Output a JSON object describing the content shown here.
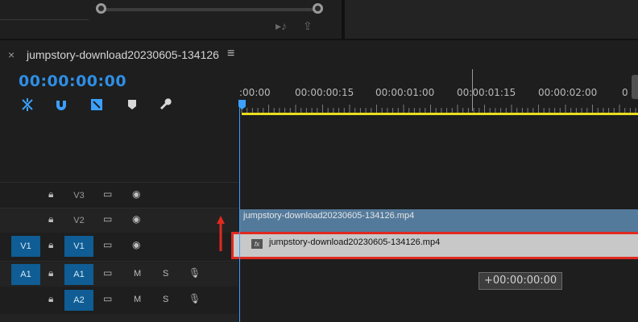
{
  "sequence": {
    "name": "jumpstory-download20230605-134126",
    "timecode": "00:00:00:00"
  },
  "ruler": {
    "labels": [
      ":00:00",
      "00:00:00:15",
      "00:00:01:00",
      "00:00:01:15",
      "00:00:02:00"
    ]
  },
  "tools": [
    "snap-icon",
    "magnet-icon",
    "linked-selection-icon",
    "marker-icon",
    "wrench-icon"
  ],
  "tracks": {
    "video": [
      {
        "name": "V3",
        "source": "",
        "active": false
      },
      {
        "name": "V2",
        "source": "",
        "active": false
      },
      {
        "name": "V1",
        "source": "V1",
        "active": true
      }
    ],
    "audio": [
      {
        "name": "A1",
        "source": "A1",
        "active": true,
        "mute": "M",
        "solo": "S"
      },
      {
        "name": "A2",
        "source": "",
        "active": false,
        "mute": "M",
        "solo": "S"
      }
    ]
  },
  "clips": {
    "v2": "jumpstory-download20230605-134126.mp4",
    "v1": "jumpstory-download20230605-134126.mp4",
    "fx_badge": "fx"
  },
  "tooltip": "+00:00:00:00",
  "colors": {
    "accent": "#2e8fe6",
    "work_area": "#e9dd1f",
    "highlight": "#e0291f",
    "track_active": "#0f5d94"
  }
}
